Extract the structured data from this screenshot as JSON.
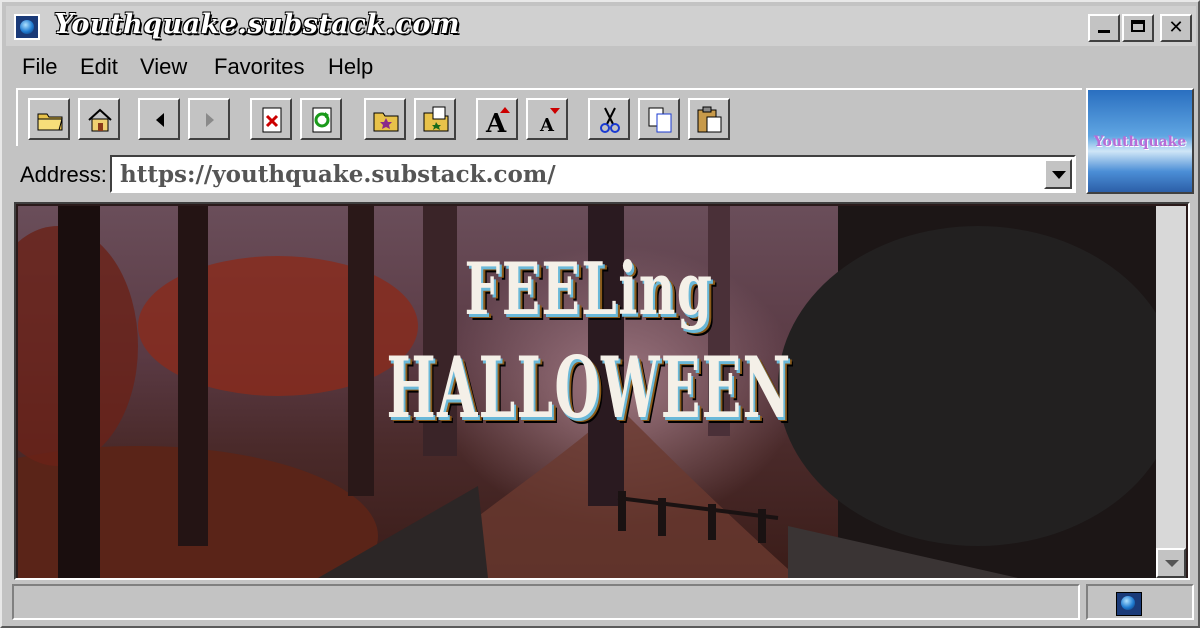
{
  "window": {
    "title": "Youthquake.substack.com"
  },
  "menu": {
    "items": [
      "File",
      "Edit",
      "View",
      "Favorites",
      "Help"
    ]
  },
  "toolbar": {
    "buttons": [
      "open-folder",
      "home",
      "back",
      "forward",
      "stop",
      "refresh",
      "favorites",
      "add-favorite",
      "font-larger",
      "font-smaller",
      "cut",
      "copy",
      "paste"
    ]
  },
  "logo": {
    "text": "Youthquake"
  },
  "address": {
    "label": "Address:",
    "url": "https://youthquake.substack.com/"
  },
  "content": {
    "headline_line1": "FEELing",
    "headline_line2": "HALLOWEEN"
  },
  "colors": {
    "chrome": "#c3c3c3",
    "title_bg": "#d0d0d0"
  }
}
